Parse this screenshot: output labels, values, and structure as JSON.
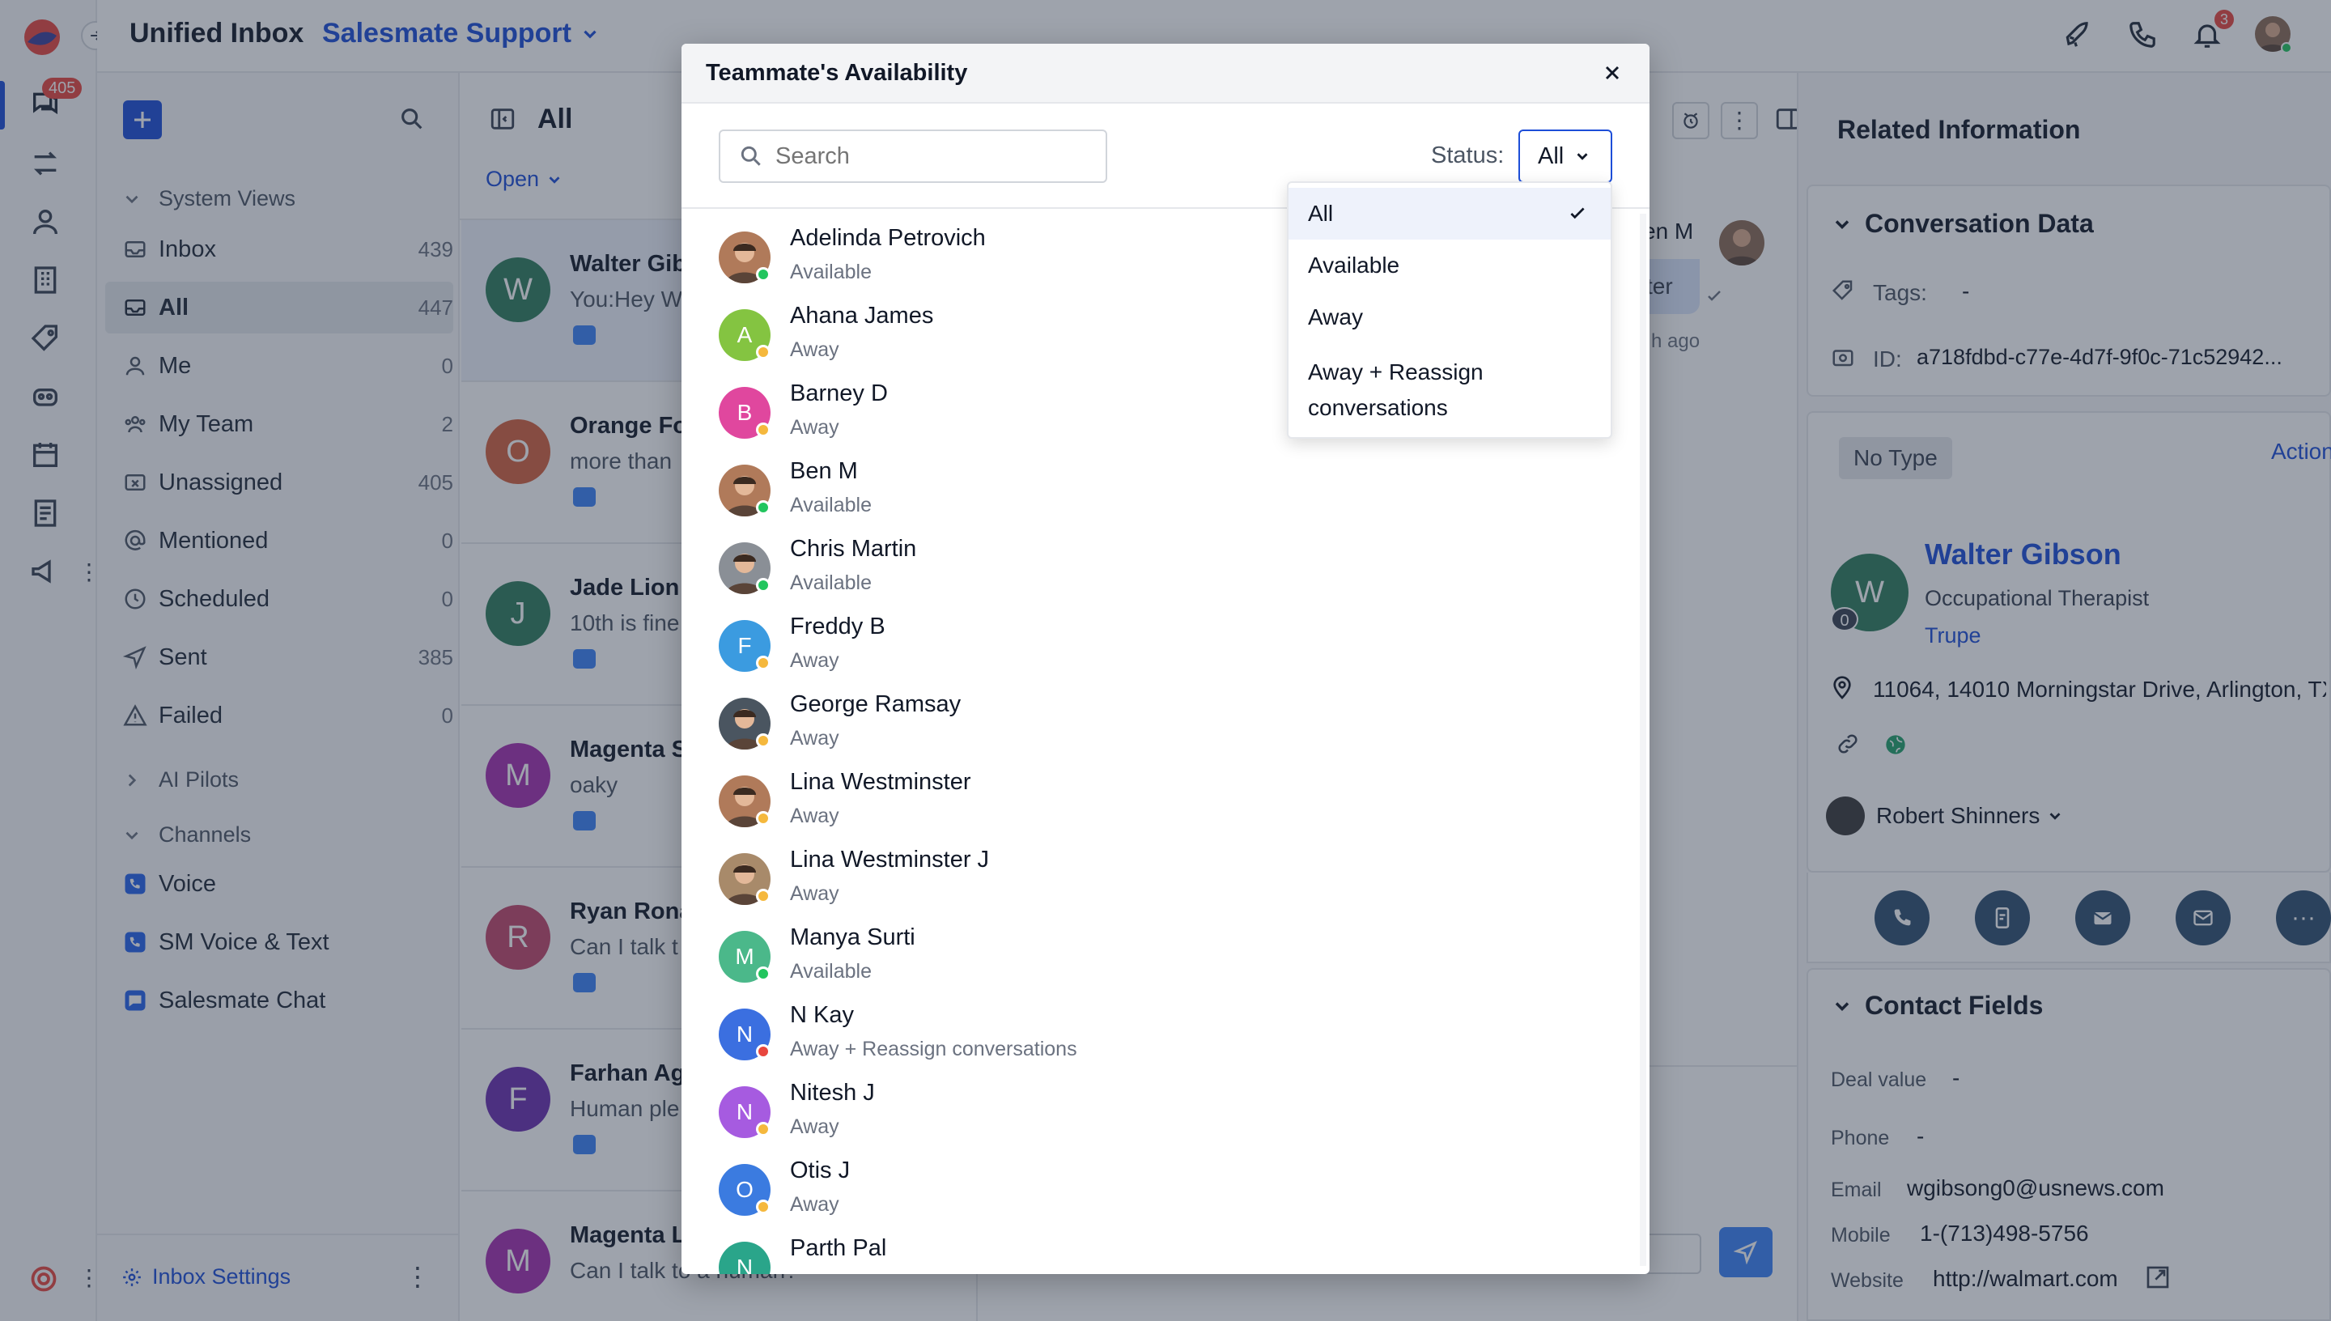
{
  "header": {
    "title": "Unified Inbox",
    "workspace": "Salesmate Support",
    "notification_count": "3",
    "nav_badge": "405"
  },
  "sidebar": {
    "system_views_label": "System Views",
    "views": [
      {
        "label": "Inbox",
        "count": "439"
      },
      {
        "label": "All",
        "count": "447"
      },
      {
        "label": "Me",
        "count": "0"
      },
      {
        "label": "My Team",
        "count": "2"
      },
      {
        "label": "Unassigned",
        "count": "405"
      },
      {
        "label": "Mentioned",
        "count": "0"
      },
      {
        "label": "Scheduled",
        "count": "0"
      },
      {
        "label": "Sent",
        "count": "385"
      },
      {
        "label": "Failed",
        "count": "0"
      }
    ],
    "ai_pilots_label": "AI Pilots",
    "channels_label": "Channels",
    "channels": [
      "Voice",
      "SM Voice & Text",
      "Salesmate Chat"
    ],
    "settings_label": "Inbox Settings"
  },
  "list": {
    "title": "All",
    "filter": "Open",
    "conversations": [
      {
        "initial": "W",
        "name": "Walter Gib",
        "preview": "You:Hey W",
        "color": "#2e7d5b"
      },
      {
        "initial": "O",
        "name": "Orange Fo",
        "preview": "more than",
        "color": "#d4623f"
      },
      {
        "initial": "J",
        "name": "Jade Lion",
        "preview": "10th is fine",
        "color": "#2e7d5b"
      },
      {
        "initial": "M",
        "name": "Magenta S",
        "preview": "oaky",
        "color": "#a52fb0"
      },
      {
        "initial": "R",
        "name": "Ryan Rona",
        "preview": "Can I talk t",
        "color": "#c2456b"
      },
      {
        "initial": "F",
        "name": "Farhan Ag",
        "preview": "Human ple",
        "color": "#6b2fb0"
      },
      {
        "initial": "M",
        "name": "Magenta L",
        "preview": "Can I talk to a human?",
        "color": "#a52fb0"
      }
    ]
  },
  "conversation_peek": {
    "name": "en M",
    "bubble": "ter",
    "time": "h ago"
  },
  "right_panel": {
    "title": "Related Information",
    "conversation_data_title": "Conversation Data",
    "tags_label": "Tags:",
    "tags_value": "-",
    "id_label": "ID:",
    "id_value": "a718fdbd-c77e-4d7f-9f0c-71c52942...",
    "type_badge": "No Type",
    "actions_label": "Action",
    "contact": {
      "initial": "W",
      "score": "0",
      "name": "Walter Gibson",
      "title": "Occupational Therapist",
      "company": "Trupe",
      "address": "11064, 14010 Morningstar Drive, Arlington, TX,",
      "owner": "Robert Shinners"
    },
    "contact_fields_title": "Contact Fields",
    "fields": [
      {
        "label": "Deal value",
        "value": "-"
      },
      {
        "label": "Phone",
        "value": "-"
      },
      {
        "label": "Email",
        "value": "wgibsong0@usnews.com"
      },
      {
        "label": "Mobile",
        "value": "1-(713)498-5756"
      },
      {
        "label": "Website",
        "value": "http://walmart.com"
      }
    ]
  },
  "modal": {
    "title": "Teammate's Availability",
    "search_placeholder": "Search",
    "status_label": "Status:",
    "status_selected": "All",
    "options": [
      "All",
      "Available",
      "Away",
      "Away + Reassign",
      "conversations"
    ],
    "members": [
      {
        "name": "Adelinda Petrovich",
        "status": "Available",
        "initial": "",
        "photo": true,
        "color": "#b07a5a",
        "dot": "#22c55e"
      },
      {
        "name": "Ahana James",
        "status": "Away",
        "initial": "A",
        "photo": false,
        "color": "#84c441",
        "dot": "#f5b83d"
      },
      {
        "name": "Barney D",
        "status": "Away",
        "initial": "B",
        "photo": false,
        "color": "#e0479e",
        "dot": "#f5b83d"
      },
      {
        "name": "Ben M",
        "status": "Available",
        "initial": "",
        "photo": true,
        "color": "#b07a5a",
        "dot": "#22c55e"
      },
      {
        "name": "Chris Martin",
        "status": "Available",
        "initial": "",
        "photo": true,
        "color": "#8a8f96",
        "dot": "#22c55e"
      },
      {
        "name": "Freddy B",
        "status": "Away",
        "initial": "F",
        "photo": false,
        "color": "#3b9be0",
        "dot": "#f5b83d"
      },
      {
        "name": "George Ramsay",
        "status": "Away",
        "initial": "",
        "photo": true,
        "color": "#4a5560",
        "dot": "#f5b83d"
      },
      {
        "name": "Lina Westminster",
        "status": "Away",
        "initial": "",
        "photo": true,
        "color": "#b07a5a",
        "dot": "#f5b83d"
      },
      {
        "name": "Lina Westminster J",
        "status": "Away",
        "initial": "",
        "photo": true,
        "color": "#a88a6a",
        "dot": "#f5b83d"
      },
      {
        "name": "Manya Surti",
        "status": "Available",
        "initial": "M",
        "photo": false,
        "color": "#4bb88a",
        "dot": "#22c55e"
      },
      {
        "name": "N Kay",
        "status": "Away + Reassign conversations",
        "initial": "N",
        "photo": false,
        "color": "#3b6fe0",
        "dot": "#e8463e"
      },
      {
        "name": "Nitesh J",
        "status": "Away",
        "initial": "N",
        "photo": false,
        "color": "#a65be0",
        "dot": "#f5b83d"
      },
      {
        "name": "Otis J",
        "status": "Away",
        "initial": "O",
        "photo": false,
        "color": "#3b7be0",
        "dot": "#f5b83d"
      },
      {
        "name": "Parth Pal",
        "status": "",
        "initial": "N",
        "photo": false,
        "color": "#2aa58a",
        "dot": "#f5b83d"
      }
    ]
  }
}
